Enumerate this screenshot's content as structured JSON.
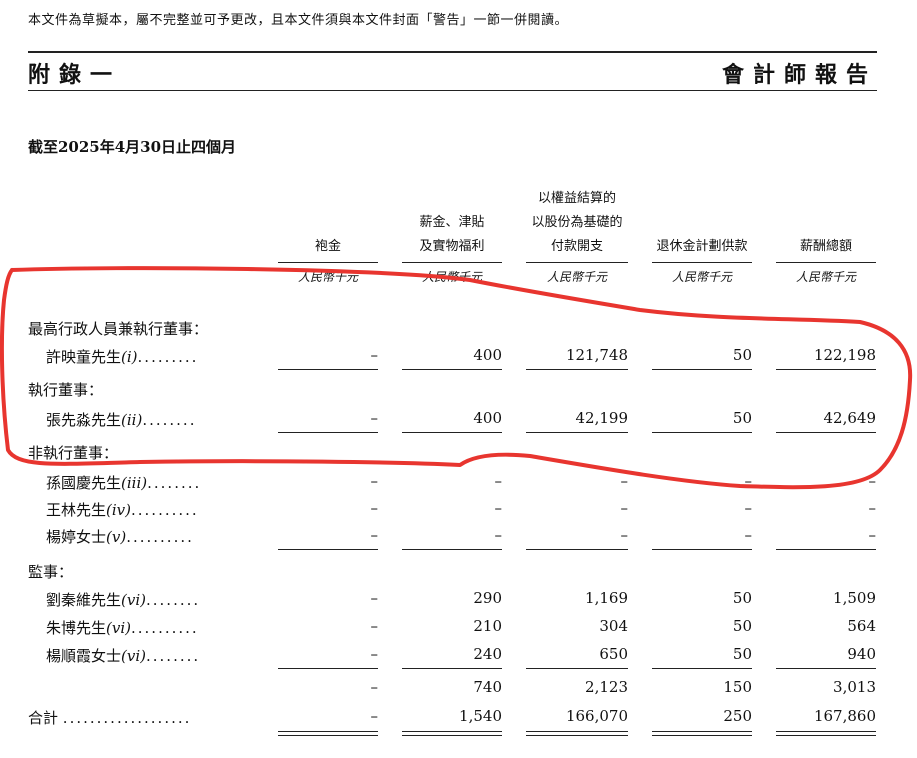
{
  "notice": "本文件為草擬本，屬不完整並可予更改，且本文件須與本文件封面「警告」一節一併閱讀。",
  "header": {
    "appendix": "附錄一",
    "report": "會計師報告"
  },
  "period": "截至2025年4月30日止四個月",
  "columns": [
    {
      "lines": [
        "袍金"
      ],
      "unit": "人民幣千元"
    },
    {
      "lines": [
        "薪金、津貼",
        "及實物福利"
      ],
      "unit": "人民幣千元"
    },
    {
      "lines": [
        "以權益結算的",
        "以股份為基礎的",
        "付款開支"
      ],
      "unit": "人民幣千元"
    },
    {
      "lines": [
        "退休金計劃供款"
      ],
      "unit": "人民幣千元"
    },
    {
      "lines": [
        "薪酬總額"
      ],
      "unit": "人民幣千元"
    }
  ],
  "sections": {
    "exec_chair": "最高行政人員兼執行董事：",
    "exec": "執行董事：",
    "nonexec": "非執行董事：",
    "supervisors": "監事："
  },
  "rows": {
    "r1": {
      "name": "許映童先生",
      "note": "(i)",
      "dots": ".........",
      "values": [
        "–",
        "400",
        "121,748",
        "50",
        "122,198"
      ]
    },
    "r2": {
      "name": "張先淼先生",
      "note": "(ii)",
      "dots": "........",
      "values": [
        "–",
        "400",
        "42,199",
        "50",
        "42,649"
      ]
    },
    "r3": {
      "name": "孫國慶先生",
      "note": "(iii)",
      "dots": "........",
      "values": [
        "–",
        "–",
        "–",
        "–",
        "–"
      ]
    },
    "r4": {
      "name": "王林先生",
      "note": "(iv)",
      "dots": "..........",
      "values": [
        "–",
        "–",
        "–",
        "–",
        "–"
      ]
    },
    "r5": {
      "name": "楊婷女士",
      "note": "(v)",
      "dots": "..........",
      "values": [
        "–",
        "–",
        "–",
        "–",
        "–"
      ]
    },
    "r6": {
      "name": "劉秦維先生",
      "note": "(vi)",
      "dots": "........",
      "values": [
        "–",
        "290",
        "1,169",
        "50",
        "1,509"
      ]
    },
    "r7": {
      "name": "朱博先生",
      "note": "(vi)",
      "dots": "..........",
      "values": [
        "–",
        "210",
        "304",
        "50",
        "564"
      ]
    },
    "r8": {
      "name": "楊順霞女士",
      "note": "(vi)",
      "dots": "........",
      "values": [
        "–",
        "240",
        "650",
        "50",
        "940"
      ]
    },
    "subtotal": {
      "values": [
        "–",
        "740",
        "2,123",
        "150",
        "3,013"
      ]
    },
    "total": {
      "name": "合計",
      "dots": "...................",
      "values": [
        "–",
        "1,540",
        "166,070",
        "250",
        "167,860"
      ]
    }
  },
  "annotation": {
    "color": "#e8352f"
  }
}
